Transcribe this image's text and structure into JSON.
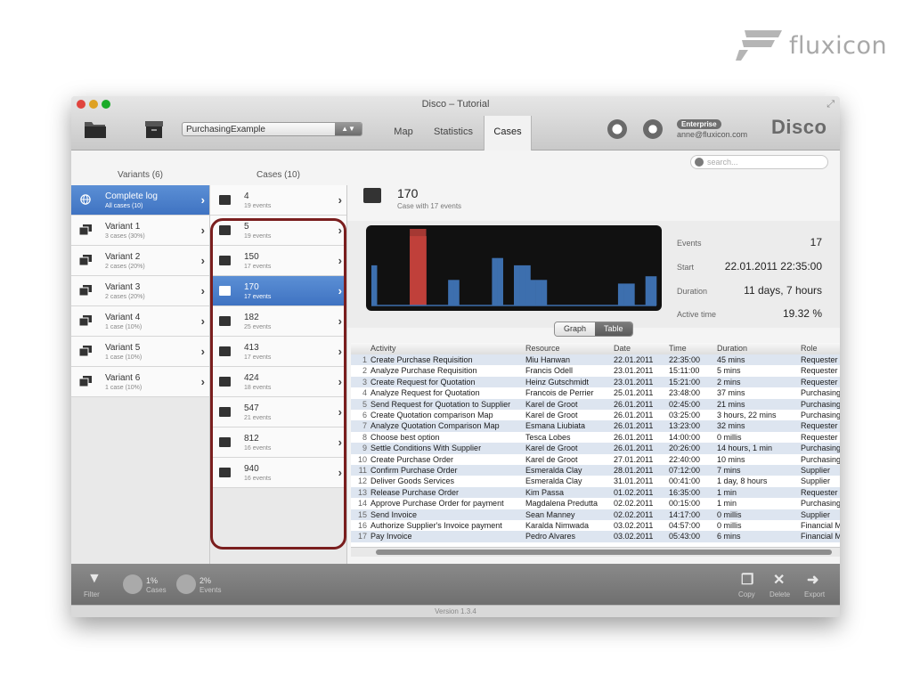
{
  "brand": {
    "name": "fluxicon"
  },
  "window": {
    "title": "Disco – Tutorial"
  },
  "toolbar": {
    "dataset": "PurchasingExample",
    "tabs": [
      {
        "label": "Map"
      },
      {
        "label": "Statistics"
      },
      {
        "label": "Cases"
      }
    ],
    "active_tab": "Cases",
    "enterprise_badge": "Enterprise",
    "user_email": "anne@fluxicon.com",
    "app_name": "Disco"
  },
  "search": {
    "placeholder": "search..."
  },
  "variants": {
    "header": "Variants (6)",
    "items": [
      {
        "title": "Complete log",
        "sub": "All cases (10)"
      },
      {
        "title": "Variant 1",
        "sub": "3 cases (30%)"
      },
      {
        "title": "Variant 2",
        "sub": "2 cases (20%)"
      },
      {
        "title": "Variant 3",
        "sub": "2 cases (20%)"
      },
      {
        "title": "Variant 4",
        "sub": "1 case (10%)"
      },
      {
        "title": "Variant 5",
        "sub": "1 case (10%)"
      },
      {
        "title": "Variant 6",
        "sub": "1 case (10%)"
      }
    ]
  },
  "cases": {
    "header": "Cases (10)",
    "items": [
      {
        "id": "4",
        "events": "19 events"
      },
      {
        "id": "5",
        "events": "19 events"
      },
      {
        "id": "150",
        "events": "17 events"
      },
      {
        "id": "170",
        "events": "17 events"
      },
      {
        "id": "182",
        "events": "25 events"
      },
      {
        "id": "413",
        "events": "17 events"
      },
      {
        "id": "424",
        "events": "18 events"
      },
      {
        "id": "547",
        "events": "21 events"
      },
      {
        "id": "812",
        "events": "16 events"
      },
      {
        "id": "940",
        "events": "16 events"
      }
    ]
  },
  "case_detail": {
    "title": "170",
    "subtitle": "Case with 17 events",
    "stats": [
      {
        "label": "Events",
        "value": "17"
      },
      {
        "label": "Start",
        "value": "22.01.2011 22:35:00"
      },
      {
        "label": "Duration",
        "value": "11 days, 7 hours"
      },
      {
        "label": "Active time",
        "value": "19.32 %"
      }
    ]
  },
  "view_toggle": {
    "graph": "Graph",
    "table": "Table",
    "active": "Table"
  },
  "events_table": {
    "columns": [
      "Activity",
      "Resource",
      "Date",
      "Time",
      "Duration",
      "Role"
    ],
    "rows": [
      {
        "n": "1",
        "activity": "Create Purchase Requisition",
        "resource": "Miu Hanwan",
        "date": "22.01.2011",
        "time": "22:35:00",
        "duration": "45 mins",
        "role": "Requester"
      },
      {
        "n": "2",
        "activity": "Analyze Purchase Requisition",
        "resource": "Francis Odell",
        "date": "23.01.2011",
        "time": "15:11:00",
        "duration": "5 mins",
        "role": "Requester"
      },
      {
        "n": "3",
        "activity": "Create Request for Quotation",
        "resource": "Heinz Gutschmidt",
        "date": "23.01.2011",
        "time": "15:21:00",
        "duration": "2 mins",
        "role": "Requester"
      },
      {
        "n": "4",
        "activity": "Analyze Request for Quotation",
        "resource": "Francois de Perrier",
        "date": "25.01.2011",
        "time": "23:48:00",
        "duration": "37 mins",
        "role": "Purchasing"
      },
      {
        "n": "5",
        "activity": "Send Request for Quotation to Supplier",
        "resource": "Karel de Groot",
        "date": "26.01.2011",
        "time": "02:45:00",
        "duration": "21 mins",
        "role": "Purchasing"
      },
      {
        "n": "6",
        "activity": "Create Quotation comparison Map",
        "resource": "Karel de Groot",
        "date": "26.01.2011",
        "time": "03:25:00",
        "duration": "3 hours, 22 mins",
        "role": "Purchasing"
      },
      {
        "n": "7",
        "activity": "Analyze Quotation Comparison Map",
        "resource": "Esmana Liubiata",
        "date": "26.01.2011",
        "time": "13:23:00",
        "duration": "32 mins",
        "role": "Requester"
      },
      {
        "n": "8",
        "activity": "Choose best option",
        "resource": "Tesca Lobes",
        "date": "26.01.2011",
        "time": "14:00:00",
        "duration": "0 millis",
        "role": "Requester"
      },
      {
        "n": "9",
        "activity": "Settle Conditions With Supplier",
        "resource": "Karel de Groot",
        "date": "26.01.2011",
        "time": "20:26:00",
        "duration": "14 hours, 1 min",
        "role": "Purchasing"
      },
      {
        "n": "10",
        "activity": "Create Purchase Order",
        "resource": "Karel de Groot",
        "date": "27.01.2011",
        "time": "22:40:00",
        "duration": "10 mins",
        "role": "Purchasing"
      },
      {
        "n": "11",
        "activity": "Confirm Purchase Order",
        "resource": "Esmeralda Clay",
        "date": "28.01.2011",
        "time": "07:12:00",
        "duration": "7 mins",
        "role": "Supplier"
      },
      {
        "n": "12",
        "activity": "Deliver Goods Services",
        "resource": "Esmeralda Clay",
        "date": "31.01.2011",
        "time": "00:41:00",
        "duration": "1 day, 8 hours",
        "role": "Supplier"
      },
      {
        "n": "13",
        "activity": "Release Purchase Order",
        "resource": "Kim Passa",
        "date": "01.02.2011",
        "time": "16:35:00",
        "duration": "1 min",
        "role": "Requester"
      },
      {
        "n": "14",
        "activity": "Approve Purchase Order for payment",
        "resource": "Magdalena Predutta",
        "date": "02.02.2011",
        "time": "00:15:00",
        "duration": "1 min",
        "role": "Purchasing"
      },
      {
        "n": "15",
        "activity": "Send Invoice",
        "resource": "Sean Manney",
        "date": "02.02.2011",
        "time": "14:17:00",
        "duration": "0 millis",
        "role": "Supplier"
      },
      {
        "n": "16",
        "activity": "Authorize Supplier's Invoice payment",
        "resource": "Karalda Nimwada",
        "date": "03.02.2011",
        "time": "04:57:00",
        "duration": "0 millis",
        "role": "Financial M"
      },
      {
        "n": "17",
        "activity": "Pay Invoice",
        "resource": "Pedro Alvares",
        "date": "03.02.2011",
        "time": "05:43:00",
        "duration": "6 mins",
        "role": "Financial M"
      }
    ]
  },
  "activity_chart": {
    "bar_heights": [
      0.55,
      0.0,
      0.0,
      0.0,
      0.0,
      0.0,
      0.0,
      0.95,
      0.95,
      0.95,
      0.0,
      0.0,
      0.0,
      0.0,
      0.35,
      0.35,
      0.0,
      0.0,
      0.0,
      0.0,
      0.0,
      0.0,
      0.65,
      0.65,
      0.0,
      0.0,
      0.55,
      0.55,
      0.55,
      0.35,
      0.35,
      0.35,
      0.0,
      0.0,
      0.0,
      0.0,
      0.0,
      0.0,
      0.0,
      0.0,
      0.0,
      0.0,
      0.0,
      0.0,
      0.0,
      0.3,
      0.3,
      0.3,
      0.0,
      0.0,
      0.4,
      0.4
    ],
    "highlight_range": [
      7,
      9
    ],
    "bar_color": "#3d6fae",
    "highlight_color": "#c0403a"
  },
  "bottom": {
    "filter_label": "Filter",
    "cases_pct": "1%",
    "cases_label": "Cases",
    "events_pct": "2%",
    "events_label": "Events",
    "copy_label": "Copy",
    "delete_label": "Delete",
    "export_label": "Export"
  },
  "status": {
    "version": "Version 1.3.4"
  }
}
